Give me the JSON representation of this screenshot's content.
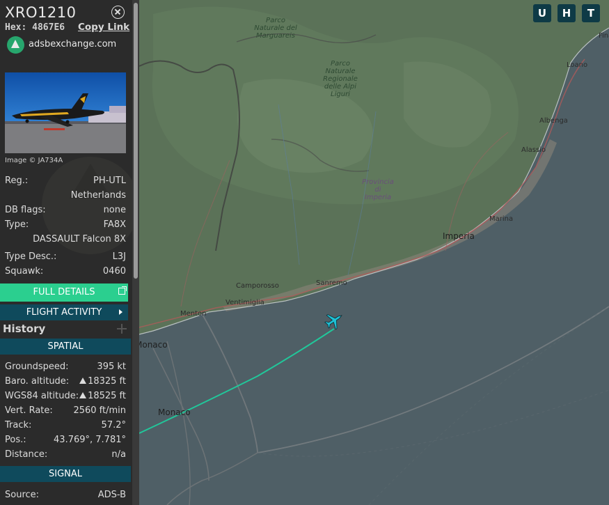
{
  "aircraft": {
    "callsign": "XRO1210",
    "hex_label": "Hex:",
    "hex": "4867E6",
    "copy_link": "Copy Link",
    "source_site": "adsbexchange.com",
    "image_credit": "Image © JA734A"
  },
  "info": {
    "reg_label": "Reg.:",
    "reg": "PH-UTL",
    "country": "Netherlands",
    "dbflags_label": "DB flags:",
    "dbflags": "none",
    "type_label": "Type:",
    "type": "FA8X",
    "type_name": "DASSAULT Falcon 8X",
    "typedesc_label": "Type Desc.:",
    "typedesc": "L3J",
    "squawk_label": "Squawk:",
    "squawk": "0460"
  },
  "buttons": {
    "full_details": "FULL DETAILS",
    "flight_activity": "FLIGHT ACTIVITY"
  },
  "history": {
    "title": "History"
  },
  "spatial": {
    "title": "SPATIAL",
    "groundspeed_label": "Groundspeed:",
    "groundspeed": "395 kt",
    "baro_label": "Baro. altitude:",
    "baro": "18325 ft",
    "wgs_label": "WGS84 altitude:",
    "wgs": "18525 ft",
    "vrate_label": "Vert. Rate:",
    "vrate": "2560 ft/min",
    "track_label": "Track:",
    "track": "57.2°",
    "pos_label": "Pos.:",
    "pos": "43.769°, 7.781°",
    "distance_label": "Distance:",
    "distance": "n/a"
  },
  "signal": {
    "title": "SIGNAL",
    "source_label": "Source:",
    "source": "ADS-B"
  },
  "map": {
    "layer_buttons": [
      "U",
      "H",
      "T"
    ],
    "labels": {
      "parco_marguareis": "Parco Naturale del Marguareis",
      "parco_alpi_liguri": "Parco Naturale Regionale delle Alpi Liguri",
      "provincia_imperia": "Provincia di Imperia",
      "imperia": "Imperia",
      "sanremo": "Sanremo",
      "camporosso": "Camporosso",
      "ventimiglia": "Ventimiglia",
      "menton": "Menton",
      "monaco_1": "Monaco",
      "monaco_2": "Monaco",
      "loano": "Loano",
      "albenga": "Albenga",
      "alassio": "Alassio",
      "marina": "Marina",
      "finale": "Fina"
    }
  },
  "colors": {
    "sidebar_bg": "#2b2b2b",
    "accent_green": "#2bcf8f",
    "section_teal": "#0f4a5c",
    "track_line": "#21c79a",
    "sea": "#4f5f66",
    "land": "#56705a"
  }
}
